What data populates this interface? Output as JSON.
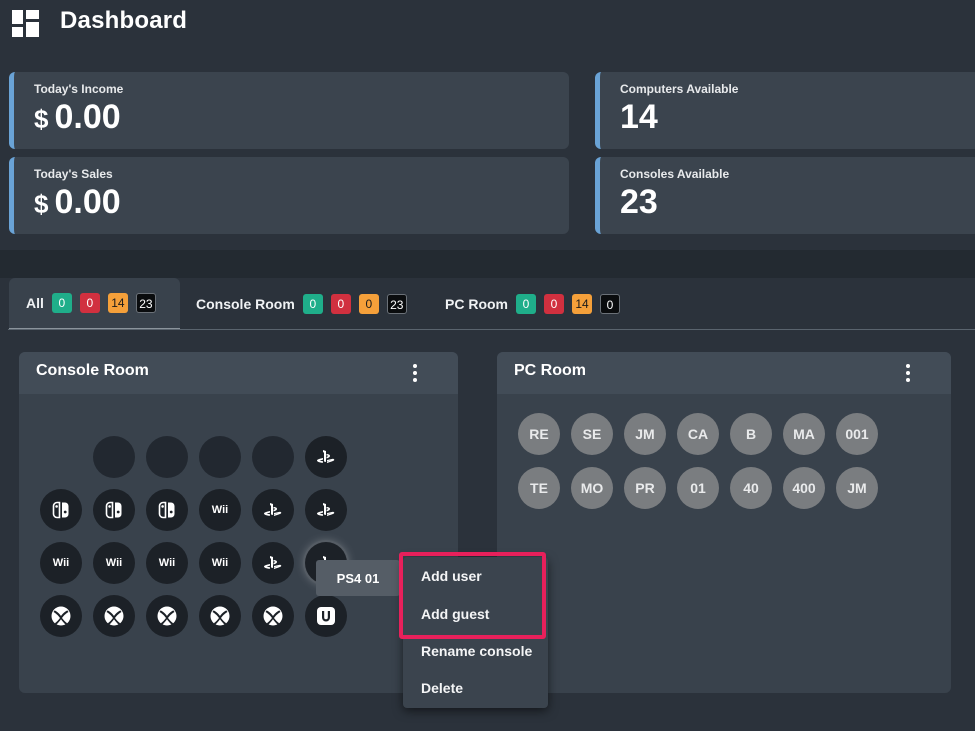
{
  "header": {
    "title": "Dashboard",
    "icon": "dashboard-icon"
  },
  "stats": {
    "income": {
      "label": "Today's Income",
      "currency": "$",
      "value": "0.00"
    },
    "sales": {
      "label": "Today's Sales",
      "currency": "$",
      "value": "0.00"
    },
    "computers": {
      "label": "Computers Available",
      "value": "14"
    },
    "consoles": {
      "label": "Consoles Available",
      "value": "23"
    }
  },
  "tabs": [
    {
      "label": "All",
      "badges": [
        "0",
        "0",
        "14",
        "23"
      ]
    },
    {
      "label": "Console Room",
      "badges": [
        "0",
        "0",
        "0",
        "23"
      ]
    },
    {
      "label": "PC Room",
      "badges": [
        "0",
        "0",
        "14",
        "0"
      ]
    }
  ],
  "console_room": {
    "title": "Console Room",
    "consoles": [
      "empty",
      "empty",
      "empty",
      "empty",
      "playstation-icon",
      "switch-icon",
      "switch-icon",
      "switch-icon",
      "Wii",
      "playstation-icon",
      "playstation-icon",
      "Wii",
      "Wii",
      "Wii",
      "Wii",
      "playstation-icon",
      "playstation-icon",
      "xbox-icon",
      "xbox-icon",
      "xbox-icon",
      "xbox-icon",
      "xbox-icon",
      "wiiu-icon"
    ]
  },
  "pc_room": {
    "title": "PC Room",
    "computers": [
      "RE",
      "SE",
      "JM",
      "CA",
      "B",
      "MA",
      "001",
      "TE",
      "MO",
      "PR",
      "01",
      "40",
      "400",
      "JM"
    ]
  },
  "tooltip": {
    "text": "PS4 01"
  },
  "context_menu": {
    "items": [
      "Add user",
      "Add guest",
      "Rename console",
      "Delete"
    ]
  },
  "colors": {
    "background": "#2b323b",
    "card": "#3b444e",
    "accent": "#6aa3d6",
    "badge_green": "#1fae8a",
    "badge_red": "#d1303f",
    "badge_orange": "#f5a03a",
    "highlight": "#e8205b"
  }
}
